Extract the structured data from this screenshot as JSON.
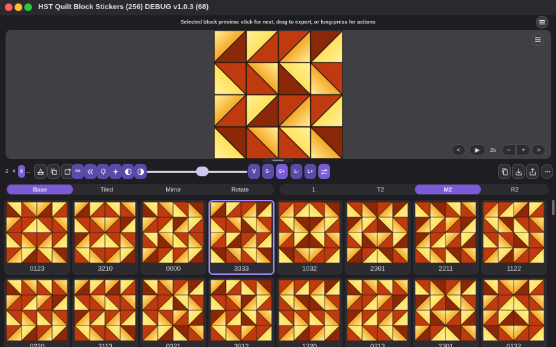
{
  "window": {
    "title": "HST Quilt Block Stickers (256) DEBUG v1.0.3 (68)",
    "hint": "Selected block preview: click for next, drag to export, or long-press for actions"
  },
  "preview": {
    "code": "3333",
    "controls": {
      "prev": "<",
      "play": "▶",
      "interval": "2s",
      "minus": "−",
      "plus": "+",
      "next": ">"
    }
  },
  "toolbar": {
    "grid_sizes": [
      "2",
      "4",
      "8",
      "..."
    ],
    "active_grid_size": "8",
    "buttons": [
      {
        "name": "rotate-tool-icon",
        "label": ""
      },
      {
        "name": "copy-tool-icon",
        "label": ""
      },
      {
        "name": "expand-tool-icon",
        "label": ""
      },
      {
        "name": "ire-button",
        "label": "ire"
      },
      {
        "name": "shift-chevrons-icon",
        "label": ""
      },
      {
        "name": "brush-icon",
        "label": ""
      },
      {
        "name": "sparkle-icon",
        "label": ""
      },
      {
        "name": "half-circle-left-icon",
        "label": ""
      },
      {
        "name": "half-circle-right-icon",
        "label": ""
      }
    ],
    "slider_value": 0.55,
    "letter_buttons": [
      "V",
      "S-",
      "S+",
      "L-",
      "L+"
    ],
    "active_letter": "S+"
  },
  "tabs_left": {
    "items": [
      "Base",
      "Tiled",
      "Mirror",
      "Rotate"
    ],
    "active": "Base"
  },
  "tabs_right": {
    "items": [
      "1",
      "T2",
      "M2",
      "R2"
    ],
    "active": "M2"
  },
  "blocks": [
    {
      "code": "0123",
      "selected": false
    },
    {
      "code": "3210",
      "selected": false
    },
    {
      "code": "0000",
      "selected": false
    },
    {
      "code": "3333",
      "selected": true
    },
    {
      "code": "1032",
      "selected": false
    },
    {
      "code": "2301",
      "selected": false
    },
    {
      "code": "2211",
      "selected": false
    },
    {
      "code": "1122",
      "selected": false
    },
    {
      "code": "0220",
      "selected": false
    },
    {
      "code": "3113",
      "selected": false
    },
    {
      "code": "0321",
      "selected": false
    },
    {
      "code": "3012",
      "selected": false
    },
    {
      "code": "1320",
      "selected": false
    },
    {
      "code": "0213",
      "selected": false
    },
    {
      "code": "2301",
      "selected": false
    },
    {
      "code": "0132",
      "selected": false
    }
  ],
  "colors": {
    "accent": "#7b5cd6",
    "selection_border": "#a18bf0",
    "quilt_light": "#ffe05a",
    "quilt_mid": "#f5a623",
    "quilt_dark": "#c03a10",
    "quilt_deep": "#8a2808"
  }
}
